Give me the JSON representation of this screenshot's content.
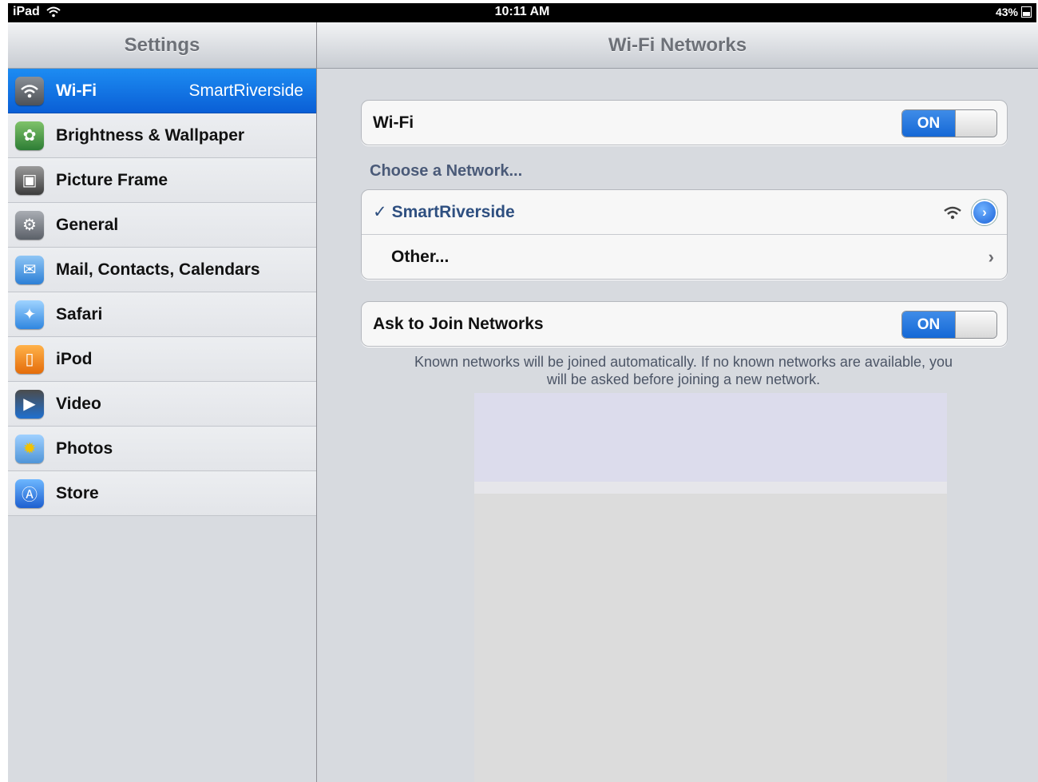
{
  "status_bar": {
    "device": "iPad",
    "time": "10:11 AM",
    "battery": "43%"
  },
  "sidebar": {
    "title": "Settings",
    "items": [
      {
        "label": "Wi-Fi",
        "value": "SmartRiverside",
        "icon": "wifi-icon",
        "selected": true
      },
      {
        "label": "Brightness & Wallpaper",
        "icon": "flower-icon"
      },
      {
        "label": "Picture Frame",
        "icon": "picture-frame-icon"
      },
      {
        "label": "General",
        "icon": "gear-icon"
      },
      {
        "label": "Mail, Contacts, Calendars",
        "icon": "envelope-icon"
      },
      {
        "label": "Safari",
        "icon": "compass-icon"
      },
      {
        "label": "iPod",
        "icon": "ipod-icon"
      },
      {
        "label": "Video",
        "icon": "clapperboard-icon"
      },
      {
        "label": "Photos",
        "icon": "sunflower-icon"
      },
      {
        "label": "Store",
        "icon": "app-store-icon"
      }
    ]
  },
  "main": {
    "title": "Wi-Fi Networks",
    "wifi": {
      "label": "Wi-Fi",
      "toggle": "ON"
    },
    "choose_label": "Choose a Network...",
    "networks": [
      {
        "name": "SmartRiverside",
        "check": "✓",
        "selected": true
      }
    ],
    "other_label": "Other...",
    "ask_join": {
      "label": "Ask to Join Networks",
      "toggle": "ON"
    },
    "footnote_line1": "Known networks will be joined automatically.  If no known networks are available, you",
    "footnote_line2": "will be asked before joining a new network."
  },
  "colors": {
    "selected_blue": "#0a5fd6",
    "toggle_blue": "#1568d6",
    "section_label": "#4a5a78"
  }
}
